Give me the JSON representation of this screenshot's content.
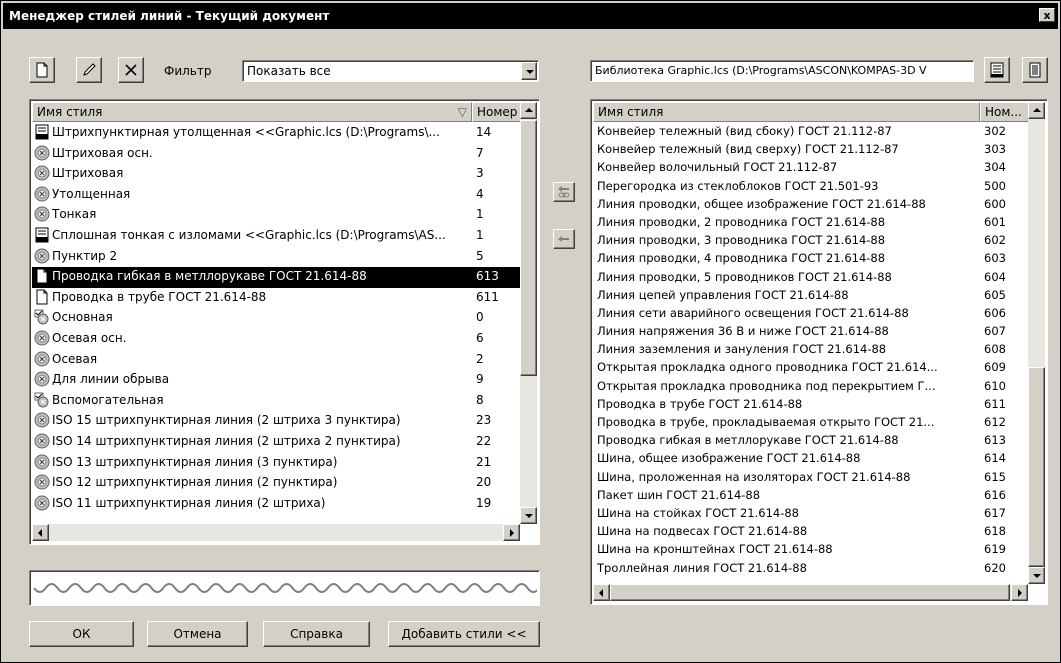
{
  "window": {
    "title": "Менеджер стилей линий - Текущий документ",
    "close_glyph": "x"
  },
  "toolbar": {
    "filter_label": "Фильтр",
    "filter_value": "Показать все",
    "icons": [
      "new-document-icon",
      "edit-pen-icon",
      "delete-x-icon"
    ]
  },
  "library": {
    "path": "Библиотека Graphic.lcs (D:\\Programs\\ASCON\\KOMPAS-3D V",
    "icons": [
      "library-list-icon",
      "library-doc-icon"
    ]
  },
  "left_list": {
    "columns": [
      "Имя стиля",
      "Номер"
    ],
    "rows": [
      {
        "icon": "library-style-icon",
        "name": "Штрихпунктирная утолщенная <<Graphic.lcs (D:\\Programs\\...",
        "num": "14"
      },
      {
        "icon": "system-style-icon",
        "name": "Штриховая осн.",
        "num": "7"
      },
      {
        "icon": "system-style-icon",
        "name": "Штриховая",
        "num": "3"
      },
      {
        "icon": "system-style-icon",
        "name": "Утолщенная",
        "num": "4"
      },
      {
        "icon": "system-style-icon",
        "name": "Тонкая",
        "num": "1"
      },
      {
        "icon": "library-style-icon",
        "name": "Сплошная тонкая с изломами <<Graphic.lcs (D:\\Programs\\AS...",
        "num": "1"
      },
      {
        "icon": "system-style-icon",
        "name": "Пунктир 2",
        "num": "5"
      },
      {
        "icon": "document-style-icon",
        "name": "Проводка гибкая в метллорукаве ГОСТ 21.614-88",
        "num": "613",
        "selected": true
      },
      {
        "icon": "document-style-icon",
        "name": "Проводка в трубе ГОСТ 21.614-88",
        "num": "611"
      },
      {
        "icon": "checked-style-icon",
        "name": "Основная",
        "num": "0"
      },
      {
        "icon": "system-style-icon",
        "name": "Осевая осн.",
        "num": "6"
      },
      {
        "icon": "system-style-icon",
        "name": "Осевая",
        "num": "2"
      },
      {
        "icon": "system-style-icon",
        "name": "Для линии обрыва",
        "num": "9"
      },
      {
        "icon": "checked-style-icon",
        "name": "Вспомогательная",
        "num": "8"
      },
      {
        "icon": "system-style-icon",
        "name": "ISO 15 штрихпунктирная линия (2 штриха 3 пунктира)",
        "num": "23"
      },
      {
        "icon": "system-style-icon",
        "name": "ISO 14 штрихпунктирная линия (2 штриха 2 пунктира)",
        "num": "22"
      },
      {
        "icon": "system-style-icon",
        "name": "ISO 13 штрихпунктирная линия (3 пунктира)",
        "num": "21"
      },
      {
        "icon": "system-style-icon",
        "name": "ISO 12 штрихпунктирная линия (2 пунктира)",
        "num": "20"
      },
      {
        "icon": "system-style-icon",
        "name": "ISO 11 штрихпунктирная линия (2 штриха)",
        "num": "19"
      }
    ]
  },
  "right_list": {
    "columns": [
      "Имя стиля",
      "Ном..."
    ],
    "rows": [
      {
        "name": "Конвейер тележный (вид сбоку) ГОСТ 21.112-87",
        "num": "302"
      },
      {
        "name": "Конвейер тележный (вид сверху) ГОСТ 21.112-87",
        "num": "303"
      },
      {
        "name": "Конвейер волочильный ГОСТ 21.112-87",
        "num": "304"
      },
      {
        "name": "Перегородка из стеклоблоков ГОСТ 21.501-93",
        "num": "500"
      },
      {
        "name": "Линия проводки, общее изображение ГОСТ 21.614-88",
        "num": "600"
      },
      {
        "name": "Линия проводки, 2 проводника ГОСТ 21.614-88",
        "num": "601"
      },
      {
        "name": "Линия проводки, 3 проводника ГОСТ 21.614-88",
        "num": "602"
      },
      {
        "name": "Линия проводки, 4 проводника ГОСТ 21.614-88",
        "num": "603"
      },
      {
        "name": "Линия проводки, 5 проводников ГОСТ 21.614-88",
        "num": "604"
      },
      {
        "name": "Линия цепей управления ГОСТ 21.614-88",
        "num": "605"
      },
      {
        "name": "Линия сети аварийного освещения ГОСТ 21.614-88",
        "num": "606"
      },
      {
        "name": "Линия напряжения 36 В и ниже ГОСТ 21.614-88",
        "num": "607"
      },
      {
        "name": "Линия заземления и зануления ГОСТ 21.614-88",
        "num": "608"
      },
      {
        "name": "Открытая прокладка одного проводника ГОСТ 21.614...",
        "num": "609"
      },
      {
        "name": "Открытая прокладка проводника под перекрытием Г...",
        "num": "610"
      },
      {
        "name": "Проводка в трубе ГОСТ 21.614-88",
        "num": "611"
      },
      {
        "name": "Проводка в трубе, прокладываемая открыто ГОСТ 21...",
        "num": "612"
      },
      {
        "name": "Проводка гибкая в метллорукаве ГОСТ 21.614-88",
        "num": "613"
      },
      {
        "name": "Шина, общее изображение ГОСТ 21.614-88",
        "num": "614"
      },
      {
        "name": "Шина, проложенная на изоляторах ГОСТ 21.614-88",
        "num": "615"
      },
      {
        "name": "Пакет шин ГОСТ 21.614-88",
        "num": "616"
      },
      {
        "name": "Шина на стойках ГОСТ 21.614-88",
        "num": "617"
      },
      {
        "name": "Шина на подвесах ГОСТ 21.614-88",
        "num": "618"
      },
      {
        "name": "Шина на кронштейнах ГОСТ 21.614-88",
        "num": "619"
      },
      {
        "name": "Троллейная линия ГОСТ 21.614-88",
        "num": "620"
      }
    ]
  },
  "transfer_buttons": [
    "copy-link-left-icon",
    "copy-left-icon"
  ],
  "buttons": {
    "ok": "ОК",
    "cancel": "Отмена",
    "help": "Справка",
    "add_styles": "Добавить стили <<"
  },
  "colors": {
    "selection": "#000000",
    "dialog": "#d4d0c8",
    "preview_line": "#808080"
  }
}
